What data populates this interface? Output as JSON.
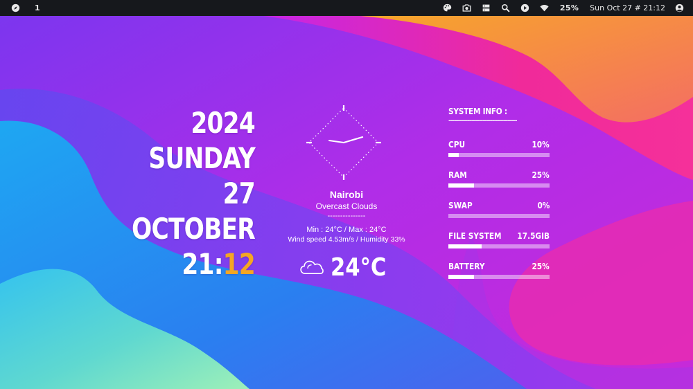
{
  "topbar": {
    "workspace": "1",
    "battery_percent": "25%",
    "clock": "Sun Oct 27 # 21:12",
    "icons": [
      "compass-icon",
      "palette-icon",
      "camera-icon",
      "server-icon",
      "search-icon",
      "play-icon",
      "wifi-icon",
      "user-icon"
    ]
  },
  "date": {
    "year": "2024",
    "weekday": "SUNDAY",
    "day": "27",
    "month": "OCTOBER",
    "hour": "21:",
    "minute": "12"
  },
  "weather": {
    "city": "Nairobi",
    "condition": "Overcast Clouds",
    "divider": "---------------",
    "minmax": "Min : 24°C / Max : 24°C",
    "wind_humidity": "Wind speed 4.53m/s / Humidity 33%",
    "temperature": "24°C",
    "icon": "cloud-icon"
  },
  "system": {
    "title": "SYSTEM INFO :",
    "divider": "------------------------------------",
    "items": [
      {
        "label": "CPU",
        "value": "10%",
        "level": 0.1
      },
      {
        "label": "RAM",
        "value": "25%",
        "level": 0.25
      },
      {
        "label": "SWAP",
        "value": "0%",
        "level": 0.0
      },
      {
        "label": "FILE SYSTEM",
        "value": "17.5GIB",
        "level": 0.33
      },
      {
        "label": "BATTERY",
        "value": "25%",
        "level": 0.25
      }
    ]
  },
  "colors": {
    "accent_minute": "#f5a623",
    "topbar_bg": "#16181c"
  }
}
